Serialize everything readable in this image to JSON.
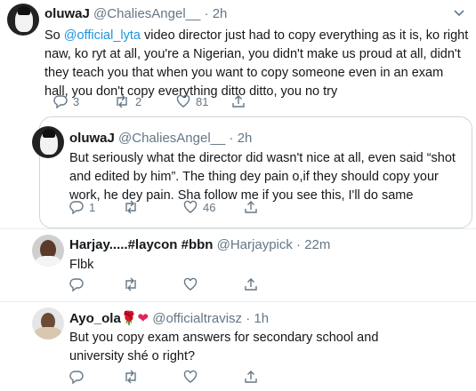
{
  "tweets": [
    {
      "name": "oluwaJ",
      "handle": "@ChaliesAngel__",
      "sep": "·",
      "time": "2h",
      "text_pre": "So ",
      "mention": "@official_lyta",
      "text_post": " video director just had to copy everything as it is, ko right naw, ko ryt at all, you're a Nigerian, you didn't make us proud at all, didn't they teach you that when you want to copy someone even in an exam hall, you don't copy everything ditto ditto, you no try",
      "replies": "3",
      "retweets": "2",
      "likes": "81"
    },
    {
      "name": "oluwaJ",
      "handle": "@ChaliesAngel__",
      "sep": "·",
      "time": "2h",
      "text": "But seriously what the director did wasn't nice at all, even said “shot and edited by him”. The thing dey pain o,if they should copy your work, he dey pain. Sha follow me if you see this, I'll do same",
      "replies": "1",
      "retweets": "",
      "likes": "46"
    },
    {
      "name": "Harjay.....#laycon #bbn",
      "handle": "@Harjaypick",
      "sep": "·",
      "time": "22m",
      "text": "Flbk",
      "replies": "",
      "retweets": "",
      "likes": ""
    },
    {
      "name": "Ayo_ola",
      "name_emoji_1": "🌹",
      "name_emoji_2": "❤",
      "handle": "@officialtravisz",
      "sep": "·",
      "time": "1h",
      "text": "But you copy exam answers  for secondary  school and university shé  o right?",
      "replies": "",
      "retweets": "",
      "likes": ""
    }
  ],
  "icons": [
    "reply-icon",
    "retweet-icon",
    "like-icon",
    "share-icon",
    "chevron-down-icon"
  ],
  "colors": {
    "link": "#1b95e0",
    "meta": "#657786",
    "border": "#ccd6dd"
  }
}
